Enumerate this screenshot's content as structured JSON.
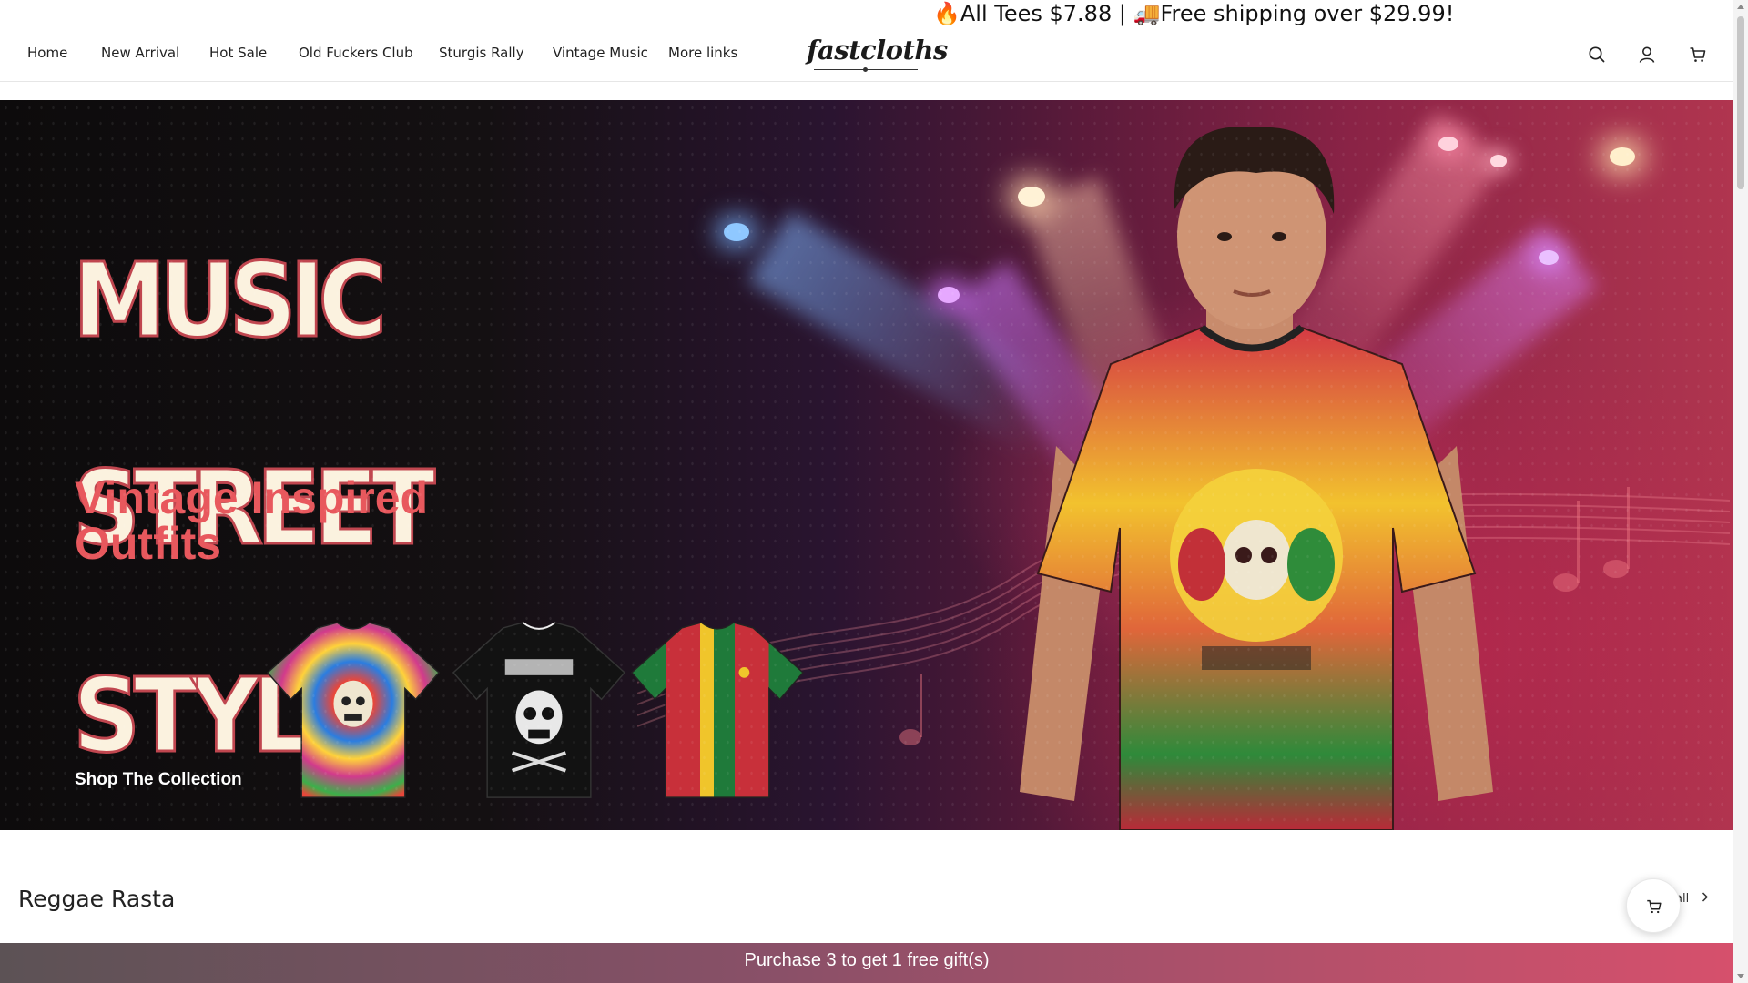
{
  "announcement": {
    "text": "🔥All Tees $7.88 | 🚚Free shipping over $29.99!"
  },
  "header": {
    "nav": [
      "Home",
      "New Arrival",
      "Hot Sale",
      "Old Fuckers Club",
      "Sturgis Rally",
      "Vintage Music",
      "More links"
    ],
    "logo": "fastcloths",
    "icons": [
      "search-icon",
      "account-icon",
      "cart-icon"
    ]
  },
  "hero": {
    "title_lines": [
      "MUSIC",
      "STREET",
      "STYLE"
    ],
    "subtitle": "Vintage Inspired Outfits",
    "cta": "Shop The Collection",
    "colors": {
      "title": "#fbf2df",
      "title_outline": "#c0464f",
      "subtitle": "#e8585d"
    }
  },
  "section": {
    "title": "Reggae Rasta",
    "view_all": "all"
  },
  "promo_bar": {
    "text": "Purchase 3 to get 1 free gift(s)"
  },
  "colors": {
    "promo_start": "#5c5255",
    "promo_end": "#d6506c"
  }
}
